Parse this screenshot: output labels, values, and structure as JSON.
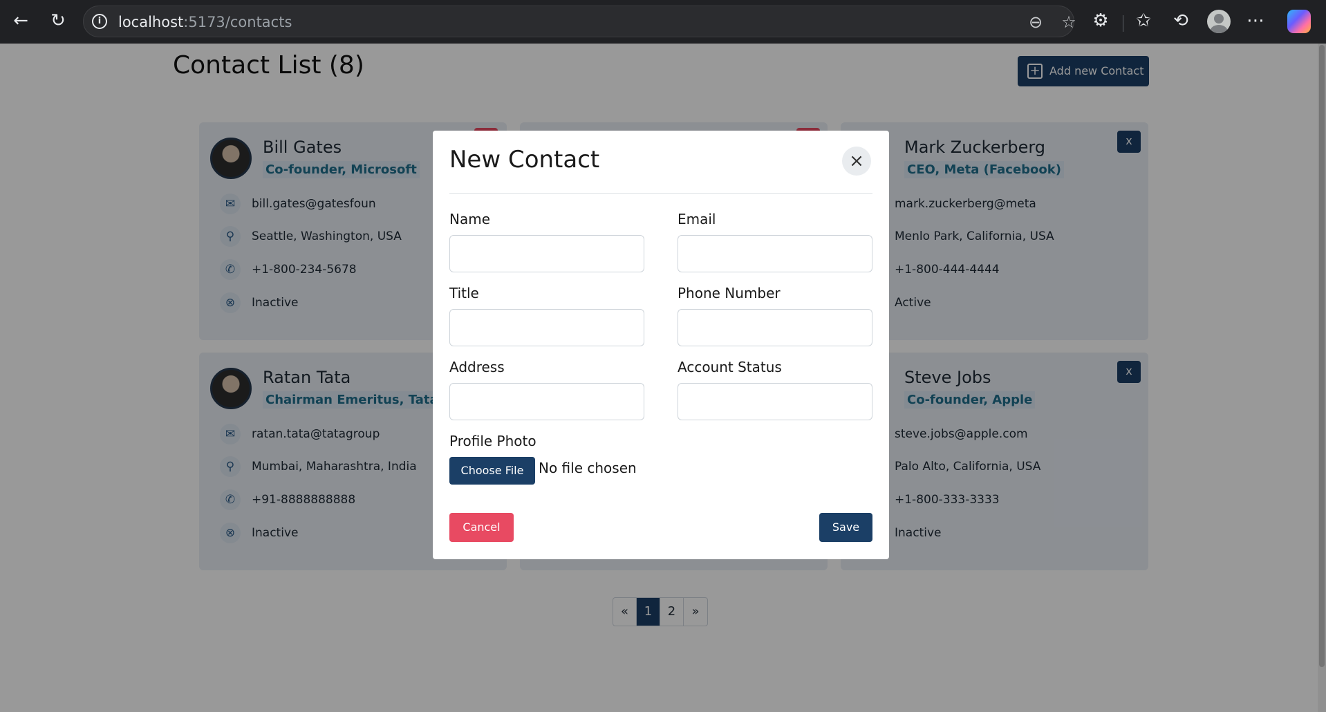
{
  "browser": {
    "url_host": "localhost",
    "url_path": ":5173/contacts",
    "icons": [
      "back-icon",
      "reload-icon",
      "site-info-icon",
      "zoom-out-icon",
      "favorite-star-icon",
      "extensions-icon",
      "favorites-icon",
      "history-icon",
      "profile-avatar",
      "more-icon",
      "copilot-icon"
    ]
  },
  "page": {
    "title": "Contact List (8)",
    "add_button": "Add new Contact"
  },
  "cards": [
    {
      "name": "Bill Gates",
      "role": "Co-founder, Microsoft",
      "email": "bill.gates@gatesfoun",
      "address": "Seattle, Washington, USA",
      "phone": "+1-800-234-5678",
      "status": "Inactive"
    },
    {
      "name": "Mark Zuckerberg",
      "role": "CEO, Meta (Facebook)",
      "email": "mark.zuckerberg@meta",
      "address": "Menlo Park, California, USA",
      "phone": "+1-800-444-4444",
      "status": "Active",
      "delete_label": "x"
    },
    {
      "name": "Ratan Tata",
      "role": "Chairman Emeritus, Tata G",
      "email": "ratan.tata@tatagroup",
      "address": "Mumbai, Maharashtra, India",
      "phone": "+91-8888888888",
      "status": "Inactive"
    },
    {
      "name": "Steve Jobs",
      "role": "Co-founder, Apple",
      "email": "steve.jobs@apple.com",
      "address": "Palo Alto, California, USA",
      "phone": "+1-800-333-3333",
      "status": "Inactive",
      "delete_label": "x"
    }
  ],
  "pagination": {
    "prev": "«",
    "pages": [
      "1",
      "2"
    ],
    "next": "»",
    "current": "1"
  },
  "modal": {
    "title": "New Contact",
    "close": "×",
    "fields": {
      "name": "Name",
      "email": "Email",
      "title": "Title",
      "phone": "Phone Number",
      "address": "Address",
      "status": "Account Status",
      "photo": "Profile Photo"
    },
    "values": {
      "name": "",
      "email": "",
      "title": "",
      "phone": "",
      "address": "",
      "status": ""
    },
    "choose_file": "Choose File",
    "no_file": "No file chosen",
    "cancel": "Cancel",
    "save": "Save"
  },
  "colors": {
    "primary": "#1b3f66",
    "danger": "#e84a62",
    "card_bg": "#e9eff6",
    "role_text": "#1f6e8c"
  }
}
